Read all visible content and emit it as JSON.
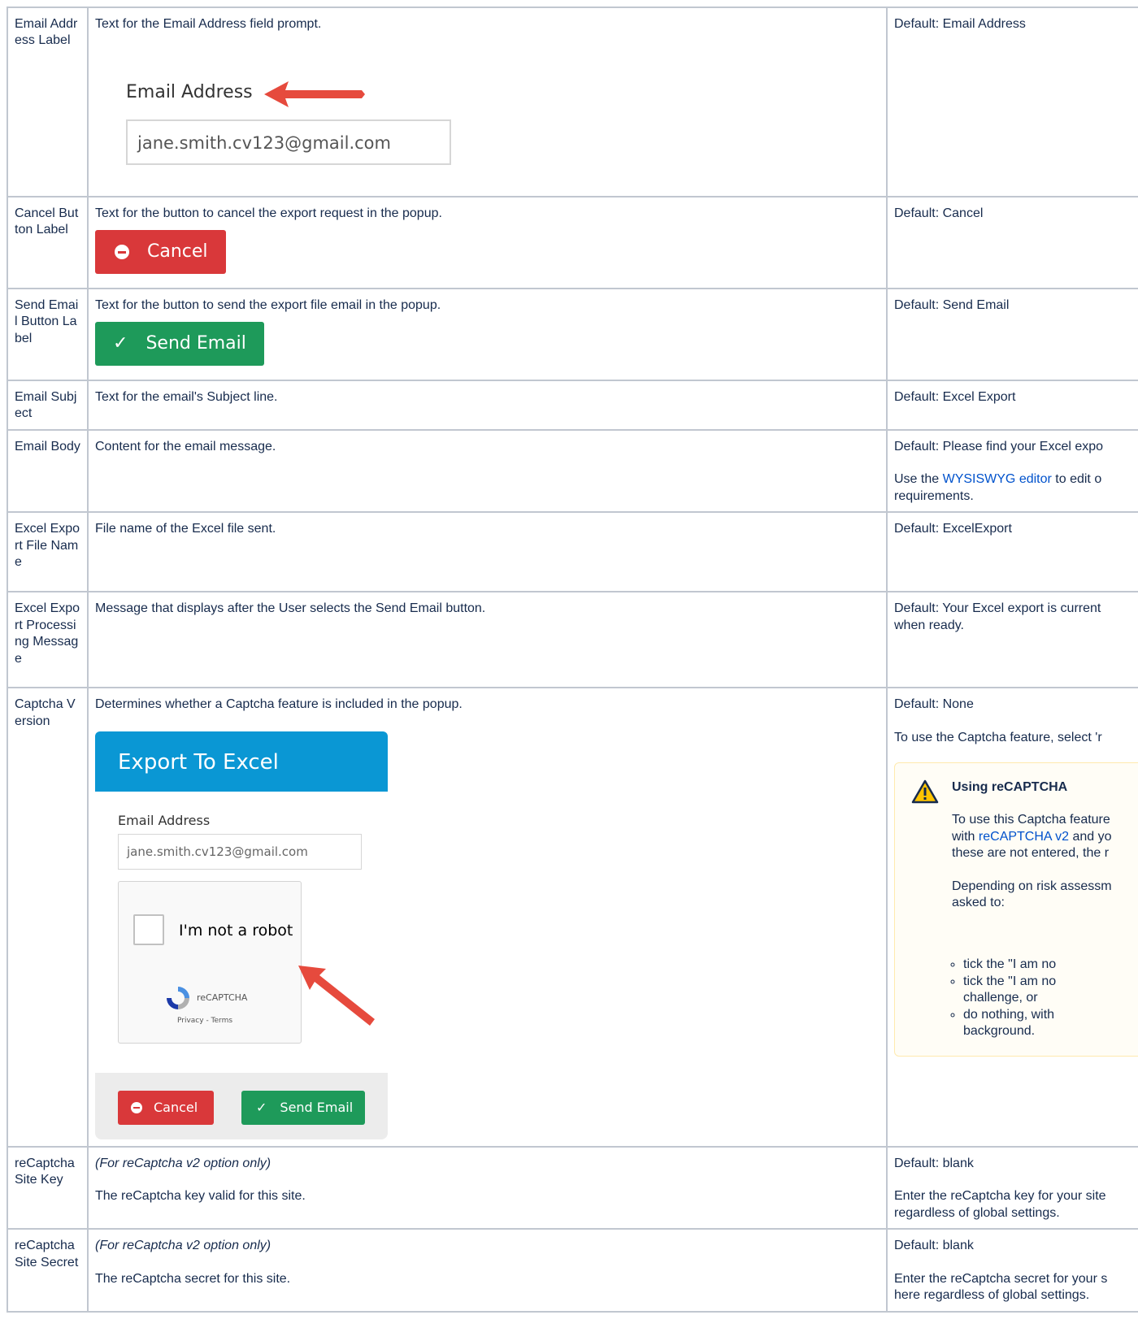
{
  "rows": [
    {
      "name": "Email Address Label",
      "description": "Text for the Email Address field prompt.",
      "default": "Default: Email Address"
    },
    {
      "name": "Cancel Button Label",
      "description": "Text for the button to cancel the export request in the popup.",
      "default": "Default: Cancel"
    },
    {
      "name": "Send Email Button Label",
      "description": "Text for the button to send the export file email in the popup.",
      "default": "Default: Send Email"
    },
    {
      "name": "Email Subject",
      "description": "Text for the email's Subject line.",
      "default": "Default: Excel Export"
    },
    {
      "name": "Email Body",
      "description": "Content for the email message.",
      "default": "Default: Please find your Excel expo",
      "note_pre": "Use the ",
      "note_link": "WYSISWYG editor",
      "note_post": " to edit o",
      "note_line2": "requirements."
    },
    {
      "name": "Excel Export File Name",
      "description": "File name of the Excel file sent.",
      "default": "Default: ExcelExport"
    },
    {
      "name": "Excel Export Processing Message",
      "description": "Message that displays after the User selects the Send Email button.",
      "default": "Default: Your Excel export is current",
      "default_line2": "when ready."
    },
    {
      "name": "Captcha Version",
      "description": "Determines whether a Captcha feature is included in the popup.",
      "default": "Default: None",
      "note": "To use the Captcha feature, select 'r"
    },
    {
      "name": "reCaptcha Site Key",
      "qualifier": "(For reCaptcha v2 option only)",
      "description": "The reCaptcha key valid for this site.",
      "default": "Default: blank",
      "note": "Enter the reCaptcha key for your site",
      "note_line2": "regardless of global settings."
    },
    {
      "name": "reCaptcha Site Secret",
      "qualifier": "(For reCaptcha v2 option only)",
      "description": "The reCaptcha secret for this site.",
      "default": "Default: blank",
      "note": "Enter the reCaptcha secret for your s",
      "note_line2": "here regardless of global settings."
    }
  ],
  "email_shot": {
    "label": "Email Address",
    "value": "jane.smith.cv123@gmail.com"
  },
  "cancel_shot": {
    "label": "Cancel",
    "icon": "minus-circle-icon"
  },
  "send_shot": {
    "label": "Send Email",
    "icon": "checkmark-icon"
  },
  "check_glyph": "✓",
  "popup": {
    "title": "Export To Excel",
    "email_label": "Email Address",
    "email_value": "jane.smith.cv123@gmail.com",
    "robot": "I'm not a robot",
    "brand": "reCAPTCHA",
    "terms": "Privacy - Terms",
    "cancel": "Cancel",
    "send": "Send Email"
  },
  "warning": {
    "title": "Using reCAPTCHA",
    "p1_l1": "To use this Captcha feature",
    "p1_l2_pre": "with ",
    "p1_l2_link": "reCAPTCHA v2",
    "p1_l2_post": " and yo",
    "p1_l3": "these are not entered, the r",
    "p2_l1": "Depending on risk assessm",
    "p2_l2": "asked to:",
    "items": [
      {
        "l1": "tick the \"I am no"
      },
      {
        "l1": "tick the \"I am no",
        "l2": "challenge, or"
      },
      {
        "l1": "do nothing, with",
        "l2": "background."
      }
    ]
  },
  "colors": {
    "border": "#c1c7d0",
    "link": "#0052cc",
    "cancel": "#d9383a",
    "send": "#1e9a5a",
    "popup_header": "#0a97d4",
    "arrow": "#e64a3d"
  }
}
